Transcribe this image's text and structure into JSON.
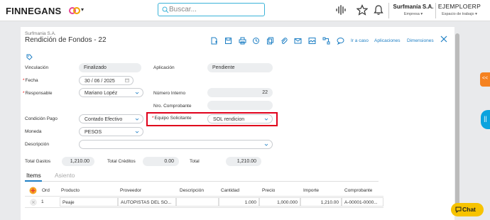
{
  "topbar": {
    "logo": "FINNEGANS",
    "search_placeholder": "Buscar...",
    "company": "Surfmanía S.A.",
    "company_sub": "Empresa",
    "workspace": "EJEMPLOERP",
    "workspace_sub": "Espacio de trabajo"
  },
  "header": {
    "company": "Surfmania S.A.",
    "title": "Rendición de Fondos - 22",
    "links": {
      "ir_a_caso": "Ir a caso",
      "aplicaciones": "Aplicaciones",
      "dimensiones": "Dimensiones"
    }
  },
  "form": {
    "vinculacion": {
      "label": "Vinculación",
      "value": "Finalizado"
    },
    "aplicacion": {
      "label": "Aplicación",
      "value": "Pendiente"
    },
    "fecha": {
      "label": "Fecha",
      "value": "30 / 06 / 2025"
    },
    "responsable": {
      "label": "Responsable",
      "value": "Mariano Lopéz"
    },
    "numero_interno": {
      "label": "Número Interno",
      "value": "22"
    },
    "nro_comprobante": {
      "label": "Nro. Comprobante",
      "value": ""
    },
    "condicion_pago": {
      "label": "Condición Pago",
      "value": "Contado Efectivo"
    },
    "equipo_solicitante": {
      "label": "Equipo Solicitante",
      "value": "SOL rendicion"
    },
    "moneda": {
      "label": "Moneda",
      "value": "PESOS"
    },
    "descripcion": {
      "label": "Descripción",
      "value": ""
    },
    "total_gastos": {
      "label": "Total Gastos",
      "value": "1,210.00"
    },
    "total_creditos": {
      "label": "Total Créditos",
      "value": "0.00"
    },
    "total": {
      "label": "Total",
      "value": "1,210.00"
    }
  },
  "tabs": {
    "items": "Items",
    "asiento": "Asiento"
  },
  "grid": {
    "headers": {
      "ord": "Ord",
      "producto": "Producto",
      "proveedor": "Proveedor",
      "descripcion": "Descripción",
      "cantidad": "Cantidad",
      "precio": "Precio",
      "importe": "Importe",
      "comprobante": "Comprobante"
    },
    "rows": [
      {
        "ord": "1",
        "producto": "Peaje",
        "proveedor": "AUTOPISTAS DEL SO...",
        "descripcion": "",
        "cantidad": "1.000",
        "precio": "1,000.000",
        "importe": "1,210.00",
        "comprobante": "A-00001-0000..."
      }
    ]
  },
  "side": {
    "collapse": "<<",
    "panel": "||"
  },
  "chat": {
    "label": "Chat"
  },
  "colors": {
    "accent": "#1e7fc4",
    "highlight_border": "#e0001b",
    "chat": "#f7c300",
    "side_orange": "#f58220",
    "side_blue": "#0aa3de"
  }
}
